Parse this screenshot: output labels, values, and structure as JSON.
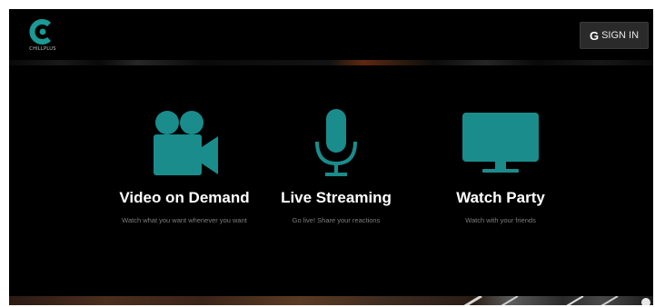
{
  "header": {
    "logo_text": "CHILLPLUS",
    "signin": {
      "icon": "google-g-icon",
      "g": "G",
      "label": "SIGN IN"
    }
  },
  "features": [
    {
      "icon": "video-camera-icon",
      "title": "Video on Demand",
      "desc": "Watch what you want whenever you want"
    },
    {
      "icon": "microphone-icon",
      "title": "Live Streaming",
      "desc": "Go live! Share your reactions"
    },
    {
      "icon": "monitor-icon",
      "title": "Watch Party",
      "desc": "Watch with your friends"
    }
  ],
  "colors": {
    "accent": "#1a8c8c",
    "background": "#000000"
  }
}
